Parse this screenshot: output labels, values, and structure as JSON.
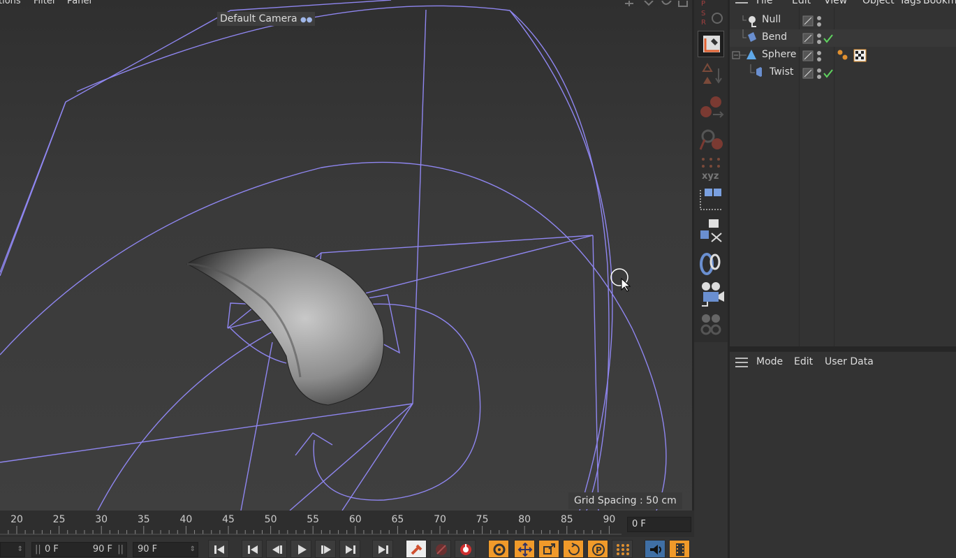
{
  "viewport": {
    "menu": [
      "tions",
      "Filter",
      "Panel"
    ],
    "camera_label": "Default Camera",
    "grid_spacing": "Grid Spacing : 50 cm"
  },
  "object_manager": {
    "menu": [
      "File",
      "Edit",
      "View",
      "Object",
      "Tags",
      "Bookm"
    ],
    "objects": [
      {
        "name": "Null",
        "icon": "null-icon",
        "enabled_check": false
      },
      {
        "name": "Bend",
        "icon": "bend-deformer-icon",
        "enabled_check": true
      },
      {
        "name": "Sphere",
        "icon": "sphere-icon",
        "enabled_check": false,
        "has_tags": true
      },
      {
        "name": "Twist",
        "icon": "twist-deformer-icon",
        "enabled_check": true
      }
    ]
  },
  "attribute_manager": {
    "menu": [
      "Mode",
      "Edit",
      "User Data"
    ]
  },
  "timeline": {
    "ticks": [
      "20",
      "25",
      "30",
      "35",
      "40",
      "45",
      "50",
      "55",
      "60",
      "65",
      "70",
      "75",
      "80",
      "85",
      "90"
    ],
    "current_frame": "0 F"
  },
  "controls": {
    "start_frame": "0 F",
    "range_start": "0 F",
    "range_end": "90 F",
    "end_frame": "90 F"
  },
  "colors": {
    "wireframe": "#8f86f0",
    "accent": "#f09a2a",
    "check": "#5fd35f"
  }
}
